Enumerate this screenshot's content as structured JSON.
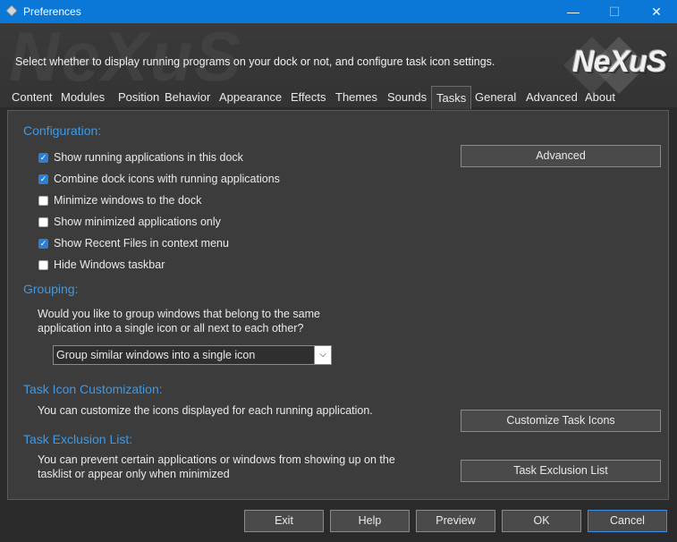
{
  "window": {
    "title": "Preferences",
    "minimize_glyph": "—",
    "maximize_glyph": "☐",
    "close_glyph": "✕"
  },
  "header": {
    "description": "Select whether to display running programs on your dock or not, and configure task icon settings.",
    "watermark_text": "NeXuS",
    "logo_text": "NeXuS"
  },
  "tabs": [
    "Content",
    "Modules",
    "Position",
    "Behavior",
    "Appearance",
    "Effects",
    "Themes",
    "Sounds",
    "Tasks",
    "General",
    "Advanced",
    "About"
  ],
  "active_tab": "Tasks",
  "configuration": {
    "heading": "Configuration:",
    "options": [
      {
        "label": "Show running applications in this dock",
        "checked": true
      },
      {
        "label": "Combine dock icons with running applications",
        "checked": true
      },
      {
        "label": "Minimize windows to the dock",
        "checked": false
      },
      {
        "label": "Show minimized applications only",
        "checked": false
      },
      {
        "label": "Show Recent Files in context menu",
        "checked": true
      },
      {
        "label": "Hide Windows taskbar",
        "checked": false
      }
    ],
    "advanced_button": "Advanced"
  },
  "grouping": {
    "heading": "Grouping:",
    "question_line1": "Would you like to group windows that belong to the same",
    "question_line2": "application into a single icon or all next to each other?",
    "selected": "Group similar windows into a single icon",
    "arrow_glyph": "⌵"
  },
  "task_icon": {
    "heading": "Task Icon Customization:",
    "text": "You can customize the icons displayed for each running application.",
    "button": "Customize Task Icons"
  },
  "task_exclusion": {
    "heading": "Task Exclusion List:",
    "text_line1": "You can prevent certain applications or windows from showing up on the",
    "text_line2": "tasklist or appear only when minimized",
    "button": "Task Exclusion List"
  },
  "footer": {
    "exit": "Exit",
    "help": "Help",
    "preview": "Preview",
    "ok": "OK",
    "cancel": "Cancel"
  },
  "colors": {
    "titlebar": "#0b78d7",
    "accent_heading": "#3d9ae8",
    "checkbox_on": "#2d7fd6"
  }
}
